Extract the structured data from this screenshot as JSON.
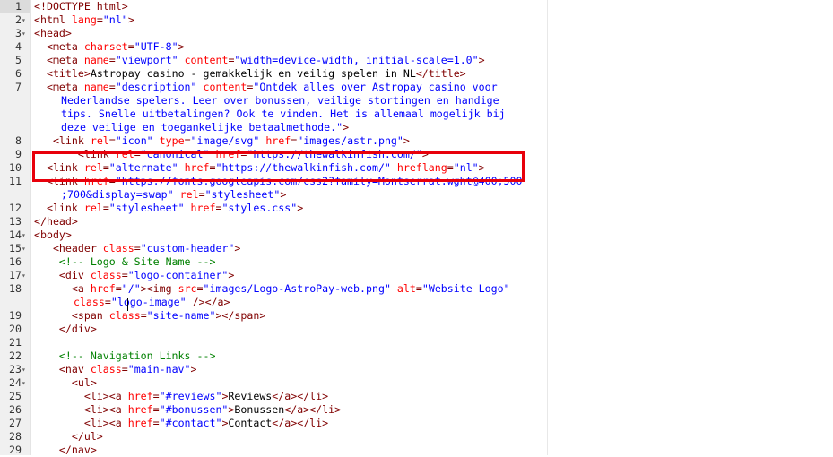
{
  "editor": {
    "language": "html",
    "colors": {
      "tag": "#800000",
      "attribute": "#ff0000",
      "string": "#0000ff",
      "comment": "#008000",
      "text": "#000000",
      "highlight_box": "#e8000b"
    },
    "lines": [
      {
        "n": "1",
        "fold": "",
        "rows": [
          [
            [
              "t-doctype",
              "<!DOCTYPE html>"
            ]
          ]
        ]
      },
      {
        "n": "2",
        "fold": "▾",
        "rows": [
          [
            [
              "t-tag",
              "<html "
            ],
            [
              "t-attr",
              "lang"
            ],
            [
              "t-tag",
              "="
            ],
            [
              "t-str",
              "\"nl\""
            ],
            [
              "t-tag",
              ">"
            ]
          ]
        ]
      },
      {
        "n": "3",
        "fold": "▾",
        "rows": [
          [
            [
              "t-tag",
              "<head>"
            ]
          ]
        ]
      },
      {
        "n": "4",
        "fold": "",
        "rows": [
          [
            [
              "t-text",
              "  "
            ],
            [
              "t-tag",
              "<meta "
            ],
            [
              "t-attr",
              "charset"
            ],
            [
              "t-tag",
              "="
            ],
            [
              "t-str",
              "\"UTF-8\""
            ],
            [
              "t-tag",
              ">"
            ]
          ]
        ]
      },
      {
        "n": "5",
        "fold": "",
        "rows": [
          [
            [
              "t-text",
              "  "
            ],
            [
              "t-tag",
              "<meta "
            ],
            [
              "t-attr",
              "name"
            ],
            [
              "t-tag",
              "="
            ],
            [
              "t-str",
              "\"viewport\""
            ],
            [
              "t-text",
              " "
            ],
            [
              "t-attr",
              "content"
            ],
            [
              "t-tag",
              "="
            ],
            [
              "t-str",
              "\"width=device-width, initial-scale=1.0\""
            ],
            [
              "t-tag",
              ">"
            ]
          ]
        ]
      },
      {
        "n": "6",
        "fold": "",
        "rows": [
          [
            [
              "t-text",
              "  "
            ],
            [
              "t-tag",
              "<title>"
            ],
            [
              "t-text",
              "Astropay casino - gemakkelijk en veilig spelen in NL"
            ],
            [
              "t-tag",
              "</title>"
            ]
          ]
        ]
      },
      {
        "n": "7",
        "fold": "",
        "rows": [
          [
            [
              "t-text",
              "  "
            ],
            [
              "t-tag",
              "<meta "
            ],
            [
              "t-attr",
              "name"
            ],
            [
              "t-tag",
              "="
            ],
            [
              "t-str",
              "\"description\""
            ],
            [
              "t-text",
              " "
            ],
            [
              "t-attr",
              "content"
            ],
            [
              "t-tag",
              "="
            ],
            [
              "t-str",
              "\"Ontdek alles over Astropay casino voor"
            ]
          ],
          [
            [
              "t-str",
              "Nederlandse spelers. Leer over bonussen, veilige stortingen en handige"
            ]
          ],
          [
            [
              "t-str",
              "tips. Snelle uitbetalingen? Ook te vinden. Het is allemaal mogelijk bij"
            ]
          ],
          [
            [
              "t-str",
              "deze veilige en toegankelijke betaalmethode.\""
            ],
            [
              "t-tag",
              ">"
            ]
          ]
        ]
      },
      {
        "n": "8",
        "fold": "",
        "rows": [
          [
            [
              "t-text",
              "   "
            ],
            [
              "t-tag",
              "<link "
            ],
            [
              "t-attr",
              "rel"
            ],
            [
              "t-tag",
              "="
            ],
            [
              "t-str",
              "\"icon\""
            ],
            [
              "t-text",
              " "
            ],
            [
              "t-attr",
              "type"
            ],
            [
              "t-tag",
              "="
            ],
            [
              "t-str",
              "\"image/svg\""
            ],
            [
              "t-text",
              " "
            ],
            [
              "t-attr",
              "href"
            ],
            [
              "t-tag",
              "="
            ],
            [
              "t-str",
              "\"images/astr.png\""
            ],
            [
              "t-tag",
              ">"
            ]
          ]
        ]
      },
      {
        "n": "9",
        "fold": "",
        "rows": [
          [
            [
              "t-text",
              "       "
            ],
            [
              "t-tag",
              "<link "
            ],
            [
              "t-attr",
              "rel"
            ],
            [
              "t-tag",
              "="
            ],
            [
              "t-str",
              "\"canonical\""
            ],
            [
              "t-text",
              " "
            ],
            [
              "t-attr",
              "href"
            ],
            [
              "t-tag",
              "="
            ],
            [
              "t-str",
              "\"https://thewalkinfish.com/\""
            ],
            [
              "t-tag",
              ">"
            ]
          ]
        ]
      },
      {
        "n": "10",
        "fold": "",
        "rows": [
          [
            [
              "t-text",
              "  "
            ],
            [
              "t-tag",
              "<link "
            ],
            [
              "t-attr",
              "rel"
            ],
            [
              "t-tag",
              "="
            ],
            [
              "t-str",
              "\"alternate\""
            ],
            [
              "t-text",
              " "
            ],
            [
              "t-attr",
              "href"
            ],
            [
              "t-tag",
              "="
            ],
            [
              "t-str",
              "\"https://thewalkinfish.com/\""
            ],
            [
              "t-text",
              " "
            ],
            [
              "t-attr",
              "hreflang"
            ],
            [
              "t-tag",
              "="
            ],
            [
              "t-str",
              "\"nl\""
            ],
            [
              "t-tag",
              ">"
            ]
          ]
        ]
      },
      {
        "n": "11",
        "fold": "",
        "rows": [
          [
            [
              "t-text",
              "  "
            ],
            [
              "t-tag",
              "<link "
            ],
            [
              "t-attr",
              "href"
            ],
            [
              "t-tag",
              "="
            ],
            [
              "t-str",
              "\"https://fonts.googleapis.com/css2?family=Montserrat:wght@400;500"
            ]
          ],
          [
            [
              "t-str",
              ";700&display=swap\""
            ],
            [
              "t-text",
              " "
            ],
            [
              "t-attr",
              "rel"
            ],
            [
              "t-tag",
              "="
            ],
            [
              "t-str",
              "\"stylesheet\""
            ],
            [
              "t-tag",
              ">"
            ]
          ]
        ]
      },
      {
        "n": "12",
        "fold": "",
        "rows": [
          [
            [
              "t-text",
              "  "
            ],
            [
              "t-tag",
              "<link "
            ],
            [
              "t-attr",
              "rel"
            ],
            [
              "t-tag",
              "="
            ],
            [
              "t-str",
              "\"stylesheet\""
            ],
            [
              "t-text",
              " "
            ],
            [
              "t-attr",
              "href"
            ],
            [
              "t-tag",
              "="
            ],
            [
              "t-str",
              "\"styles.css\""
            ],
            [
              "t-tag",
              ">"
            ]
          ]
        ]
      },
      {
        "n": "13",
        "fold": "",
        "rows": [
          [
            [
              "t-tag",
              "</head>"
            ]
          ]
        ]
      },
      {
        "n": "14",
        "fold": "▾",
        "rows": [
          [
            [
              "t-tag",
              "<body>"
            ]
          ]
        ]
      },
      {
        "n": "15",
        "fold": "▾",
        "rows": [
          [
            [
              "t-text",
              "   "
            ],
            [
              "t-tag",
              "<header "
            ],
            [
              "t-attr",
              "class"
            ],
            [
              "t-tag",
              "="
            ],
            [
              "t-str",
              "\"custom-header\""
            ],
            [
              "t-tag",
              ">"
            ]
          ]
        ]
      },
      {
        "n": "16",
        "fold": "",
        "rows": [
          [
            [
              "t-text",
              "    "
            ],
            [
              "t-comment",
              "<!-- Logo & Site Name -->"
            ]
          ]
        ]
      },
      {
        "n": "17",
        "fold": "▾",
        "rows": [
          [
            [
              "t-text",
              "    "
            ],
            [
              "t-tag",
              "<div "
            ],
            [
              "t-attr",
              "class"
            ],
            [
              "t-tag",
              "="
            ],
            [
              "t-str",
              "\"logo-container\""
            ],
            [
              "t-tag",
              ">"
            ]
          ]
        ]
      },
      {
        "n": "18",
        "fold": "",
        "rows": [
          [
            [
              "t-text",
              "      "
            ],
            [
              "t-tag",
              "<a "
            ],
            [
              "t-attr",
              "href"
            ],
            [
              "t-tag",
              "="
            ],
            [
              "t-str",
              "\"/\""
            ],
            [
              "t-tag",
              "><img "
            ],
            [
              "t-attr",
              "src"
            ],
            [
              "t-tag",
              "="
            ],
            [
              "t-str",
              "\"images/Logo-AstroPay-web.png\""
            ],
            [
              "t-text",
              " "
            ],
            [
              "t-attr",
              "alt"
            ],
            [
              "t-tag",
              "="
            ],
            [
              "t-str",
              "\"Website Logo\""
            ]
          ],
          [
            [
              "t-text",
              "  "
            ],
            [
              "t-attr",
              "class"
            ],
            [
              "t-tag",
              "="
            ],
            [
              "t-str",
              "\"logo-image\""
            ],
            [
              "t-text",
              " "
            ],
            [
              "t-tag",
              "/></a>"
            ]
          ]
        ]
      },
      {
        "n": "19",
        "fold": "",
        "rows": [
          [
            [
              "t-text",
              "      "
            ],
            [
              "t-tag",
              "<span "
            ],
            [
              "t-attr",
              "class"
            ],
            [
              "t-tag",
              "="
            ],
            [
              "t-str",
              "\"site-name\""
            ],
            [
              "t-tag",
              "></span>"
            ]
          ]
        ]
      },
      {
        "n": "20",
        "fold": "",
        "rows": [
          [
            [
              "t-text",
              "    "
            ],
            [
              "t-tag",
              "</div>"
            ]
          ]
        ]
      },
      {
        "n": "21",
        "fold": "",
        "rows": [
          [
            [
              "t-text",
              ""
            ]
          ]
        ]
      },
      {
        "n": "22",
        "fold": "",
        "rows": [
          [
            [
              "t-text",
              "    "
            ],
            [
              "t-comment",
              "<!-- Navigation Links -->"
            ]
          ]
        ]
      },
      {
        "n": "23",
        "fold": "▾",
        "rows": [
          [
            [
              "t-text",
              "    "
            ],
            [
              "t-tag",
              "<nav "
            ],
            [
              "t-attr",
              "class"
            ],
            [
              "t-tag",
              "="
            ],
            [
              "t-str",
              "\"main-nav\""
            ],
            [
              "t-tag",
              ">"
            ]
          ]
        ]
      },
      {
        "n": "24",
        "fold": "▾",
        "rows": [
          [
            [
              "t-text",
              "      "
            ],
            [
              "t-tag",
              "<ul>"
            ]
          ]
        ]
      },
      {
        "n": "25",
        "fold": "",
        "rows": [
          [
            [
              "t-text",
              "        "
            ],
            [
              "t-tag",
              "<li><a "
            ],
            [
              "t-attr",
              "href"
            ],
            [
              "t-tag",
              "="
            ],
            [
              "t-str",
              "\"#reviews\""
            ],
            [
              "t-tag",
              ">"
            ],
            [
              "t-text",
              "Reviews"
            ],
            [
              "t-tag",
              "</a></li>"
            ]
          ]
        ]
      },
      {
        "n": "26",
        "fold": "",
        "rows": [
          [
            [
              "t-text",
              "        "
            ],
            [
              "t-tag",
              "<li><a "
            ],
            [
              "t-attr",
              "href"
            ],
            [
              "t-tag",
              "="
            ],
            [
              "t-str",
              "\"#bonussen\""
            ],
            [
              "t-tag",
              ">"
            ],
            [
              "t-text",
              "Bonussen"
            ],
            [
              "t-tag",
              "</a></li>"
            ]
          ]
        ]
      },
      {
        "n": "27",
        "fold": "",
        "rows": [
          [
            [
              "t-text",
              "        "
            ],
            [
              "t-tag",
              "<li><a "
            ],
            [
              "t-attr",
              "href"
            ],
            [
              "t-tag",
              "="
            ],
            [
              "t-str",
              "\"#contact\""
            ],
            [
              "t-tag",
              ">"
            ],
            [
              "t-text",
              "Contact"
            ],
            [
              "t-tag",
              "</a></li>"
            ]
          ]
        ]
      },
      {
        "n": "28",
        "fold": "",
        "rows": [
          [
            [
              "t-text",
              "      "
            ],
            [
              "t-tag",
              "</ul>"
            ]
          ]
        ]
      },
      {
        "n": "29",
        "fold": "",
        "rows": [
          [
            [
              "t-text",
              "    "
            ],
            [
              "t-tag",
              "</nav>"
            ]
          ]
        ]
      }
    ]
  }
}
